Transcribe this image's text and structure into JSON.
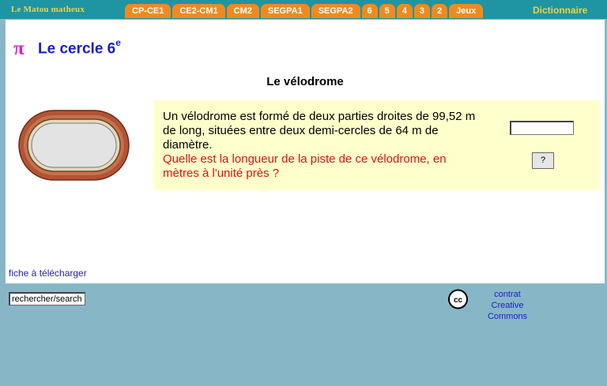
{
  "header": {
    "brand": "Le Matou matheux",
    "tabs": [
      "CP-CE1",
      "CE2-CM1",
      "CM2",
      "SEGPA1",
      "SEGPA2",
      "6",
      "5",
      "4",
      "3",
      "2",
      "Jeux"
    ],
    "dictionary": "Dictionnaire"
  },
  "page": {
    "title": "Le cercle 6",
    "title_sup": "e",
    "subtitle": "Le vélodrome"
  },
  "question": {
    "text": "Un vélodrome est formé de deux parties droites de 99,52 m de long, situées entre deux demi-cercles de 64 m de diamètre.",
    "prompt": "Quelle est la longueur de la piste de ce vélodrome, en mètres à l'unité près ?",
    "answer_value": "",
    "button_label": "?"
  },
  "footer": {
    "download_link": "fiche à télécharger",
    "search_value": "rechercher/search",
    "license_line1": "contrat",
    "license_line2": "Creative Commons"
  },
  "colors": {
    "topbar": "#1f95a3",
    "tab": "#f08a1e",
    "brand": "#f4d23b",
    "background": "#87b7c7",
    "question_box": "#ffffcc",
    "title": "#1c1cc9",
    "prompt_red": "#e01010"
  },
  "icons": [
    "pi-icon",
    "velodrome-track-icon",
    "creative-commons-icon"
  ]
}
